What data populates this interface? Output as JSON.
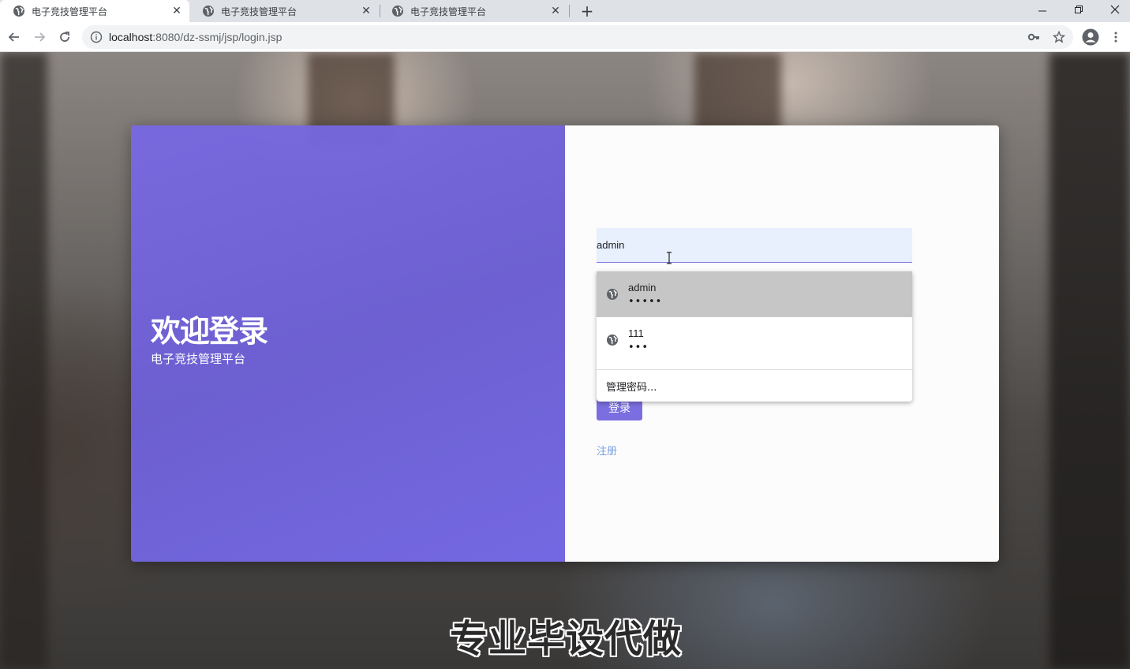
{
  "browser": {
    "tabs": [
      {
        "title": "电子竞技管理平台",
        "active": true
      },
      {
        "title": "电子竞技管理平台",
        "active": false
      },
      {
        "title": "电子竞技管理平台",
        "active": false
      }
    ],
    "url_host": "localhost",
    "url_path": ":8080/dz-ssmj/jsp/login.jsp"
  },
  "login": {
    "welcome_title": "欢迎登录",
    "platform_name": "电子竞技管理平台",
    "username_value": "admin",
    "login_label": "登录",
    "register_label": "注册"
  },
  "autofill": {
    "suggestions": [
      {
        "username": "admin",
        "password_mask": "•••••"
      },
      {
        "username": "111",
        "password_mask": "•••"
      }
    ],
    "manage_label": "管理密码..."
  },
  "overlay": {
    "watermark": "专业毕设代做"
  },
  "colors": {
    "panel_purple": "#7868e2",
    "button_purple": "#7b6ee0",
    "link_blue": "#7a9fe0",
    "autofill_bg": "#e8f0fe"
  }
}
